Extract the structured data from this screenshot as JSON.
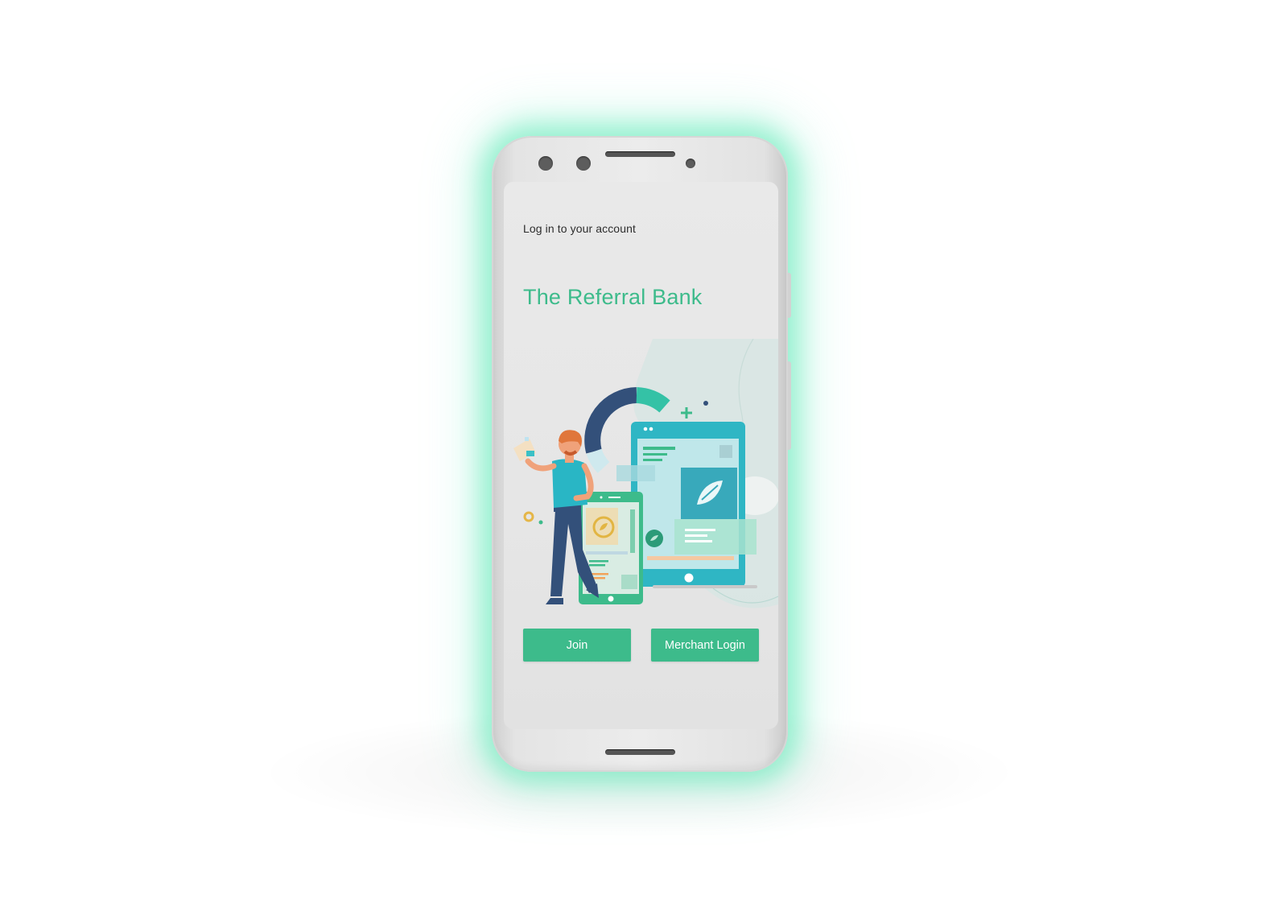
{
  "screen": {
    "subtitle": "Log in to your account",
    "title": "The Referral Bank"
  },
  "actions": {
    "join_label": "Join",
    "merchant_login_label": "Merchant Login"
  },
  "colors": {
    "brand_green": "#3dbb8b",
    "glow": "#5ce8b4",
    "illustration_teal": "#2fb6c4",
    "illustration_navy": "#33507a"
  }
}
